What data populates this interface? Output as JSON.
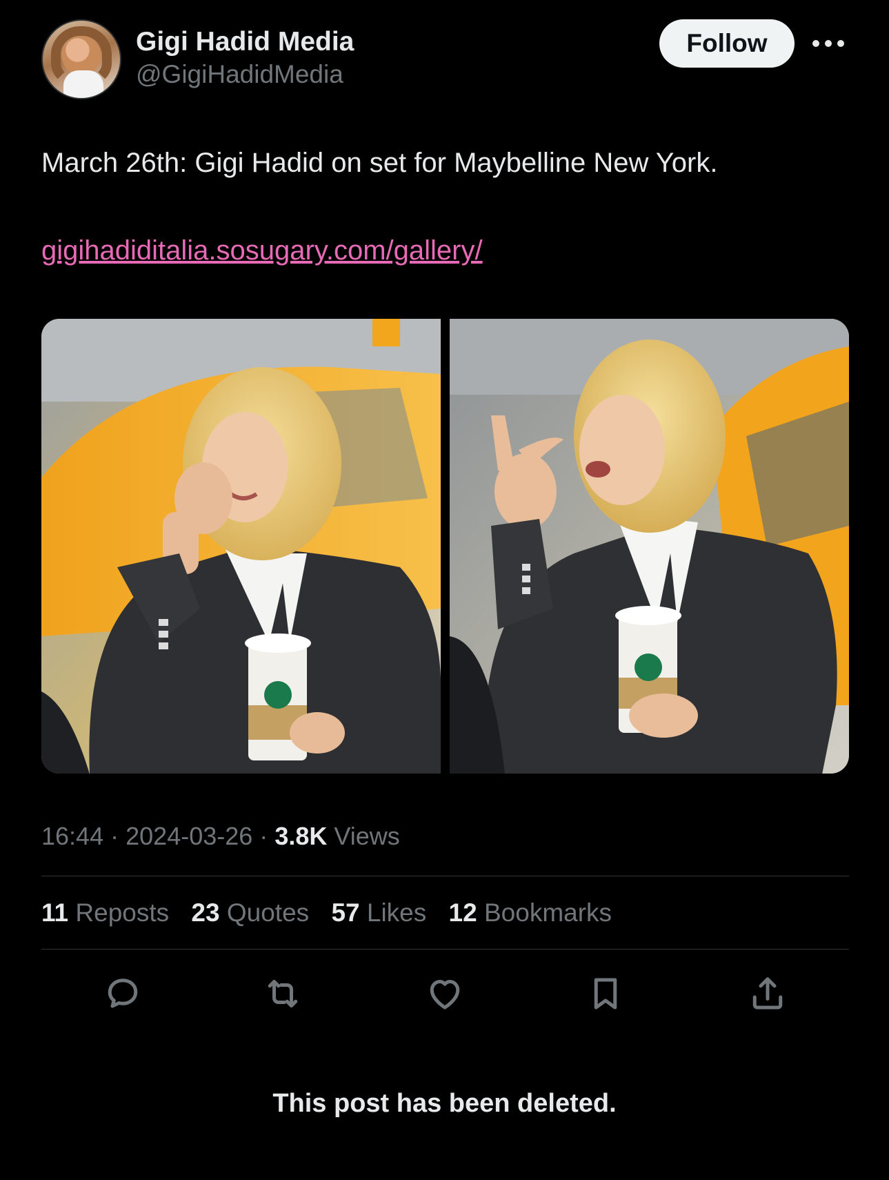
{
  "author": {
    "display_name": "Gigi Hadid Media",
    "handle": "@GigiHadidMedia",
    "avatar_icon": "profile-photo",
    "follow_label": "Follow",
    "more_icon": "more-options-icon"
  },
  "tweet": {
    "text": "March 26th: Gigi Hadid on set for Maybelline New York.",
    "link": "gigihadiditalia.sosugary.com/gallery/",
    "link_color": "#e76ab7",
    "media_count": 2
  },
  "meta": {
    "time": "16:44",
    "date": "2024-03-26",
    "separator": "·",
    "views_count": "3.8K",
    "views_label": "Views"
  },
  "stats": [
    {
      "count": "11",
      "label": "Reposts"
    },
    {
      "count": "23",
      "label": "Quotes"
    },
    {
      "count": "57",
      "label": "Likes"
    },
    {
      "count": "12",
      "label": "Bookmarks"
    }
  ],
  "actions": [
    {
      "name": "reply",
      "icon": "reply-icon"
    },
    {
      "name": "repost",
      "icon": "repost-icon"
    },
    {
      "name": "like",
      "icon": "heart-icon"
    },
    {
      "name": "bookmark",
      "icon": "bookmark-icon"
    },
    {
      "name": "share",
      "icon": "share-icon"
    }
  ],
  "notice": "This post has been deleted.",
  "colors": {
    "background": "#000000",
    "text_primary": "#e7e9ea",
    "text_secondary": "#71767b",
    "follow_bg": "#eff3f4",
    "divider": "#2f3336"
  }
}
